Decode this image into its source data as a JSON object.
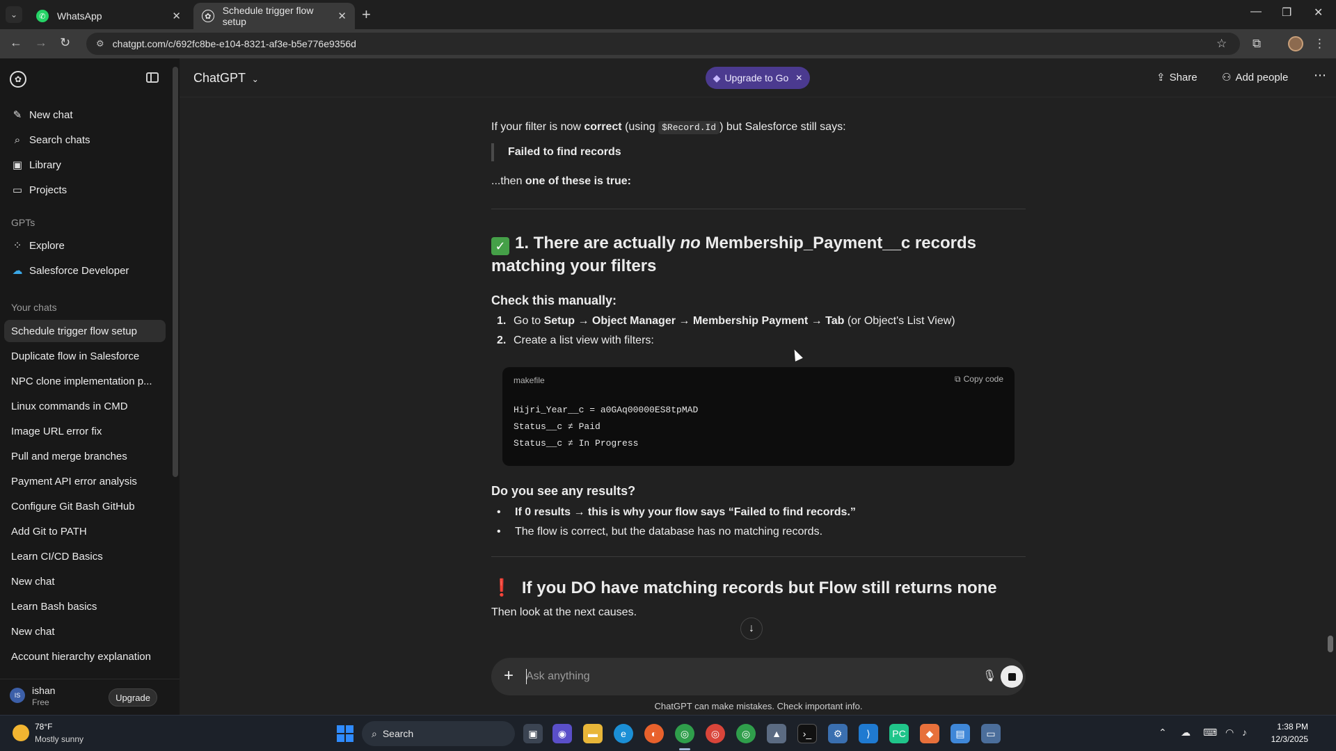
{
  "browser": {
    "tabs": [
      {
        "title": "WhatsApp",
        "icon": "whatsapp-icon",
        "color": "#25d366"
      },
      {
        "title": "Schedule trigger flow setup",
        "icon": "chatgpt-icon",
        "color": "#ececec"
      }
    ],
    "url": "chatgpt.com/c/692fc8be-e104-8321-af3e-b5e776e9356d"
  },
  "sidebar": {
    "main_items": [
      {
        "label": "New chat",
        "icon": "compose-icon"
      },
      {
        "label": "Search chats",
        "icon": "search-icon"
      },
      {
        "label": "Library",
        "icon": "library-icon"
      },
      {
        "label": "Projects",
        "icon": "folder-icon"
      }
    ],
    "gpts_heading": "GPTs",
    "gpt_items": [
      {
        "label": "Explore",
        "icon": "explore-icon"
      },
      {
        "label": "Salesforce Developer",
        "icon": "salesforce-icon"
      }
    ],
    "chats_heading": "Your chats",
    "chats": [
      "Schedule trigger flow setup",
      "Duplicate flow in Salesforce",
      "NPC clone implementation p...",
      "Linux commands in CMD",
      "Image URL error fix",
      "Pull and merge branches",
      "Payment API error analysis",
      "Configure Git Bash GitHub",
      "Add Git to PATH",
      "Learn CI/CD Basics",
      "New chat",
      "Learn Bash basics",
      "New chat",
      "Account hierarchy explanation"
    ],
    "user": {
      "initials": "IS",
      "name": "ishan",
      "plan": "Free",
      "upgrade_label": "Upgrade"
    }
  },
  "header": {
    "model": "ChatGPT",
    "upgrade_pill": "Upgrade to Go",
    "share": "Share",
    "add_people": "Add people"
  },
  "message": {
    "intro_pre": "If your filter is now ",
    "intro_bold": "correct",
    "intro_mid": " (using ",
    "intro_code": "$Record.Id",
    "intro_post": ") but Salesforce still says:",
    "quote": "Failed to find records",
    "then_pre": "...then ",
    "then_bold": "one of these is true:",
    "h1_pre": "1. There are actually ",
    "h1_em": "no",
    "h1_post": " Membership_Payment__c records matching your filters",
    "check_heading": "Check this manually:",
    "step1_num": "1.",
    "step1_pre": "Go to ",
    "step1_bold": "Setup → Object Manager → Membership Payment → Tab",
    "step1_post": " (or Object's List View)",
    "step2_num": "2.",
    "step2": "Create a list view with filters:",
    "code": {
      "lang": "makefile",
      "copy_label": "Copy code",
      "lines": [
        "Hijri_Year__c = a0GAq00000ES8tpMAD",
        "Status__c ≠ Paid",
        "Status__c ≠ In Progress"
      ]
    },
    "results_heading": "Do you see any results?",
    "bullet1": "If 0 results → this is why your flow says “Failed to find records.”",
    "bullet2": "The flow is correct, but the database has no matching records.",
    "h2_mark": "❗",
    "h2": "If you DO have matching records but Flow still returns none",
    "next": "Then look at the next causes."
  },
  "composer": {
    "placeholder": "Ask anything",
    "disclaimer": "ChatGPT can make mistakes. Check important info."
  },
  "taskbar": {
    "weather_temp": "78°F",
    "weather_desc": "Mostly sunny",
    "search_label": "Search",
    "time": "1:38 PM",
    "date": "12/3/2025"
  },
  "colors": {
    "accent_purple": "#4b3a8f",
    "check_green": "#45a048",
    "alert_red": "#e5484d"
  }
}
